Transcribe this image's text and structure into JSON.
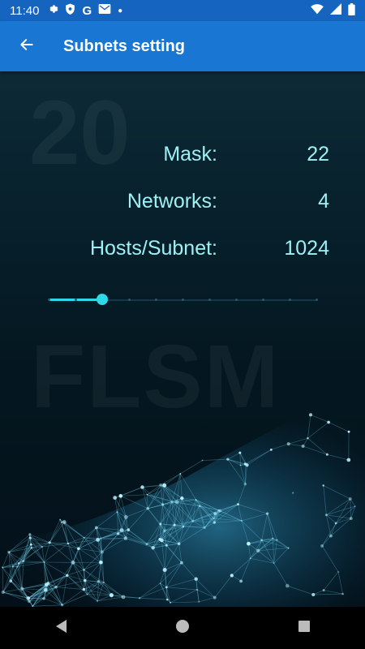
{
  "status_bar": {
    "time": "11:40"
  },
  "app_bar": {
    "title": "Subnets setting"
  },
  "background": {
    "number": "20",
    "word": "FLSM"
  },
  "rows": [
    {
      "label": "Mask:",
      "value": "22"
    },
    {
      "label": "Networks:",
      "value": "4"
    },
    {
      "label": "Hosts/Subnet:",
      "value": "1024"
    }
  ],
  "slider": {
    "position": 0.2,
    "ticks": 10
  },
  "colors": {
    "accent": "#2fd8e6",
    "app_bar": "#1976d2",
    "status_bar": "#1565c0",
    "text": "#9ff0f4"
  }
}
